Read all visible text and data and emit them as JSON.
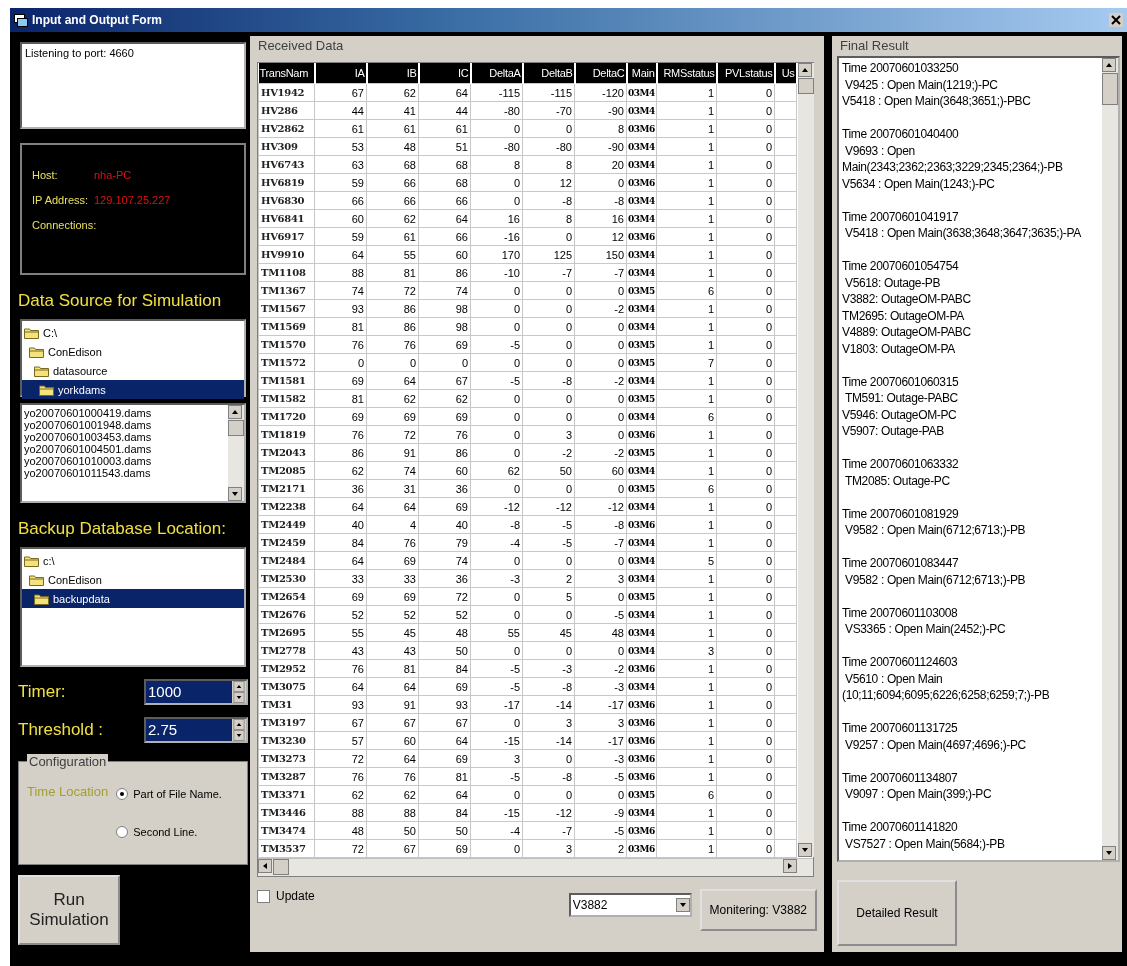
{
  "window": {
    "title": "Input and Output Form"
  },
  "listener": {
    "log": "Listening to port: 4660"
  },
  "server_info": [
    {
      "label": "Host:",
      "value": "nha-PC"
    },
    {
      "label": "IP Address:",
      "value": "129.107.25.227"
    },
    {
      "label": "Connections:"
    }
  ],
  "data_source": {
    "heading": "Data Source for Simulation",
    "tree": [
      {
        "label": "C:\\",
        "selected": false,
        "children": [
          {
            "label": "ConEdison",
            "selected": false,
            "children": [
              {
                "label": "datasource",
                "selected": false,
                "children": [
                  {
                    "label": "yorkdams",
                    "selected": true
                  }
                ]
              }
            ]
          }
        ]
      }
    ],
    "files": [
      "yo20070601000419.dams",
      "yo20070601001948.dams",
      "yo20070601003453.dams",
      "yo20070601004501.dams",
      "yo20070601010003.dams",
      "yo20070601011543.dams"
    ]
  },
  "backup": {
    "heading": "Backup Database Location:",
    "tree": [
      {
        "label": "c:\\",
        "selected": false,
        "children": [
          {
            "label": "ConEdison",
            "selected": false,
            "children": [
              {
                "label": "backupdata",
                "selected": true
              }
            ]
          }
        ]
      }
    ]
  },
  "timer": {
    "label": "Timer:",
    "value": "1000"
  },
  "threshold": {
    "label": "Threshold :",
    "value": "2.75"
  },
  "configuration": {
    "title": "Configuration",
    "label": "Time Location",
    "options": [
      {
        "label": "Part of File Name.",
        "selected": true
      },
      {
        "label": "Second Line.",
        "selected": false
      }
    ]
  },
  "run_button": "Run Simulation",
  "received": {
    "title": "Received Data",
    "columns": [
      "TransNam",
      "IA",
      "IB",
      "IC",
      "DeltaA",
      "DeltaB",
      "DeltaC",
      "Main",
      "RMSstatus",
      "PVLstatus",
      "Us"
    ],
    "rows": [
      [
        "HV1942",
        "67",
        "62",
        "64",
        "-115",
        "-115",
        "-120",
        "03M4",
        "1",
        "0"
      ],
      [
        "HV286",
        "44",
        "41",
        "44",
        "-80",
        "-70",
        "-90",
        "03M4",
        "1",
        "0"
      ],
      [
        "HV2862",
        "61",
        "61",
        "61",
        "0",
        "0",
        "8",
        "03M6",
        "1",
        "0"
      ],
      [
        "HV309",
        "53",
        "48",
        "51",
        "-80",
        "-80",
        "-90",
        "03M4",
        "1",
        "0"
      ],
      [
        "HV6743",
        "63",
        "68",
        "68",
        "8",
        "8",
        "20",
        "03M4",
        "1",
        "0"
      ],
      [
        "HV6819",
        "59",
        "66",
        "68",
        "0",
        "12",
        "0",
        "03M6",
        "1",
        "0"
      ],
      [
        "HV6830",
        "66",
        "66",
        "66",
        "0",
        "-8",
        "-8",
        "03M4",
        "1",
        "0"
      ],
      [
        "HV6841",
        "60",
        "62",
        "64",
        "16",
        "8",
        "16",
        "03M4",
        "1",
        "0"
      ],
      [
        "HV6917",
        "59",
        "61",
        "66",
        "-16",
        "0",
        "12",
        "03M6",
        "1",
        "0"
      ],
      [
        "HV9910",
        "64",
        "55",
        "60",
        "170",
        "125",
        "150",
        "03M4",
        "1",
        "0"
      ],
      [
        "TM1108",
        "88",
        "81",
        "86",
        "-10",
        "-7",
        "-7",
        "03M4",
        "1",
        "0"
      ],
      [
        "TM1367",
        "74",
        "72",
        "74",
        "0",
        "0",
        "0",
        "03M5",
        "6",
        "0"
      ],
      [
        "TM1567",
        "93",
        "86",
        "98",
        "0",
        "0",
        "-2",
        "03M4",
        "1",
        "0"
      ],
      [
        "TM1569",
        "81",
        "86",
        "98",
        "0",
        "0",
        "0",
        "03M4",
        "1",
        "0"
      ],
      [
        "TM1570",
        "76",
        "76",
        "69",
        "-5",
        "0",
        "0",
        "03M5",
        "1",
        "0"
      ],
      [
        "TM1572",
        "0",
        "0",
        "0",
        "0",
        "0",
        "0",
        "03M5",
        "7",
        "0"
      ],
      [
        "TM1581",
        "69",
        "64",
        "67",
        "-5",
        "-8",
        "-2",
        "03M4",
        "1",
        "0"
      ],
      [
        "TM1582",
        "81",
        "62",
        "62",
        "0",
        "0",
        "0",
        "03M5",
        "1",
        "0"
      ],
      [
        "TM1720",
        "69",
        "69",
        "69",
        "0",
        "0",
        "0",
        "03M4",
        "6",
        "0"
      ],
      [
        "TM1819",
        "76",
        "72",
        "76",
        "0",
        "3",
        "0",
        "03M6",
        "1",
        "0"
      ],
      [
        "TM2043",
        "86",
        "91",
        "86",
        "0",
        "-2",
        "-2",
        "03M5",
        "1",
        "0"
      ],
      [
        "TM2085",
        "62",
        "74",
        "60",
        "62",
        "50",
        "60",
        "03M4",
        "1",
        "0"
      ],
      [
        "TM2171",
        "36",
        "31",
        "36",
        "0",
        "0",
        "0",
        "03M5",
        "6",
        "0"
      ],
      [
        "TM2238",
        "64",
        "64",
        "69",
        "-12",
        "-12",
        "-12",
        "03M4",
        "1",
        "0"
      ],
      [
        "TM2449",
        "40",
        "4",
        "40",
        "-8",
        "-5",
        "-8",
        "03M6",
        "1",
        "0"
      ],
      [
        "TM2459",
        "84",
        "76",
        "79",
        "-4",
        "-5",
        "-7",
        "03M4",
        "1",
        "0"
      ],
      [
        "TM2484",
        "64",
        "69",
        "74",
        "0",
        "0",
        "0",
        "03M4",
        "5",
        "0"
      ],
      [
        "TM2530",
        "33",
        "33",
        "36",
        "-3",
        "2",
        "3",
        "03M4",
        "1",
        "0"
      ],
      [
        "TM2654",
        "69",
        "69",
        "72",
        "0",
        "5",
        "0",
        "03M5",
        "1",
        "0"
      ],
      [
        "TM2676",
        "52",
        "52",
        "52",
        "0",
        "0",
        "-5",
        "03M4",
        "1",
        "0"
      ],
      [
        "TM2695",
        "55",
        "45",
        "48",
        "55",
        "45",
        "48",
        "03M4",
        "1",
        "0"
      ],
      [
        "TM2778",
        "43",
        "43",
        "50",
        "0",
        "0",
        "0",
        "03M4",
        "3",
        "0"
      ],
      [
        "TM2952",
        "76",
        "81",
        "84",
        "-5",
        "-3",
        "-2",
        "03M6",
        "1",
        "0"
      ],
      [
        "TM3075",
        "64",
        "64",
        "69",
        "-5",
        "-8",
        "-3",
        "03M4",
        "1",
        "0"
      ],
      [
        "TM31",
        "93",
        "91",
        "93",
        "-17",
        "-14",
        "-17",
        "03M6",
        "1",
        "0"
      ],
      [
        "TM3197",
        "67",
        "67",
        "67",
        "0",
        "3",
        "3",
        "03M6",
        "1",
        "0"
      ],
      [
        "TM3230",
        "57",
        "60",
        "64",
        "-15",
        "-14",
        "-17",
        "03M6",
        "1",
        "0"
      ],
      [
        "TM3273",
        "72",
        "64",
        "69",
        "3",
        "0",
        "-3",
        "03M6",
        "1",
        "0"
      ],
      [
        "TM3287",
        "76",
        "76",
        "81",
        "-5",
        "-8",
        "-5",
        "03M6",
        "1",
        "0"
      ],
      [
        "TM3371",
        "62",
        "62",
        "64",
        "0",
        "0",
        "0",
        "03M5",
        "6",
        "0"
      ],
      [
        "TM3446",
        "88",
        "88",
        "84",
        "-15",
        "-12",
        "-9",
        "03M4",
        "1",
        "0"
      ],
      [
        "TM3474",
        "48",
        "50",
        "50",
        "-4",
        "-7",
        "-5",
        "03M6",
        "1",
        "0"
      ],
      [
        "TM3537",
        "72",
        "67",
        "69",
        "0",
        "3",
        "2",
        "03M6",
        "1",
        "0"
      ]
    ]
  },
  "update": {
    "label": "Update",
    "checked": false
  },
  "vehicle_select": {
    "value": "V3882"
  },
  "monitor_button": "Monitering: V3882",
  "final_result": {
    "title": "Final Result",
    "groups": [
      {
        "time": "Time 20070601033250",
        "lines": [
          " V9425 : Open Main(1219;)-PC",
          "V5418 : Open Main(3648;3651;)-PBC"
        ]
      },
      {
        "time": "Time 20070601040400",
        "lines": [
          " V9693 : Open Main(2343;2362;2363;3229;2345;2364;)-PB",
          "V5634 : Open Main(1243;)-PC"
        ]
      },
      {
        "time": "Time 20070601041917",
        "lines": [
          " V5418 : Open Main(3638;3648;3647;3635;)-PA"
        ]
      },
      {
        "time": "Time 20070601054754",
        "lines": [
          " V5618: Outage-PB",
          "V3882: OutageOM-PABC",
          "TM2695: OutageOM-PA",
          "V4889: OutageOM-PABC",
          "V1803: OutageOM-PA"
        ]
      },
      {
        "time": "Time 20070601060315",
        "lines": [
          " TM591: Outage-PABC",
          "V5946: OutageOM-PC",
          "V5907: Outage-PAB"
        ]
      },
      {
        "time": "Time 20070601063332",
        "lines": [
          " TM2085: Outage-PC"
        ]
      },
      {
        "time": "Time 20070601081929",
        "lines": [
          " V9582 : Open Main(6712;6713;)-PB"
        ]
      },
      {
        "time": "Time 20070601083447",
        "lines": [
          " V9582 : Open Main(6712;6713;)-PB"
        ]
      },
      {
        "time": "Time 20070601103008",
        "lines": [
          " VS3365 : Open Main(2452;)-PC"
        ]
      },
      {
        "time": "Time 20070601124603",
        "lines": [
          " V5610 : Open Main (10;11;6094;6095;6226;6258;6259;7;)-PB"
        ]
      },
      {
        "time": "Time 20070601131725",
        "lines": [
          " V9257 : Open Main(4697;4696;)-PC"
        ]
      },
      {
        "time": "Time 20070601134807",
        "lines": [
          " V9097 : Open Main(399;)-PC"
        ]
      },
      {
        "time": "Time 20070601141820",
        "lines": [
          " VS7527 : Open Main(5684;)-PB"
        ]
      }
    ]
  },
  "detail_button": "Detailed Result"
}
